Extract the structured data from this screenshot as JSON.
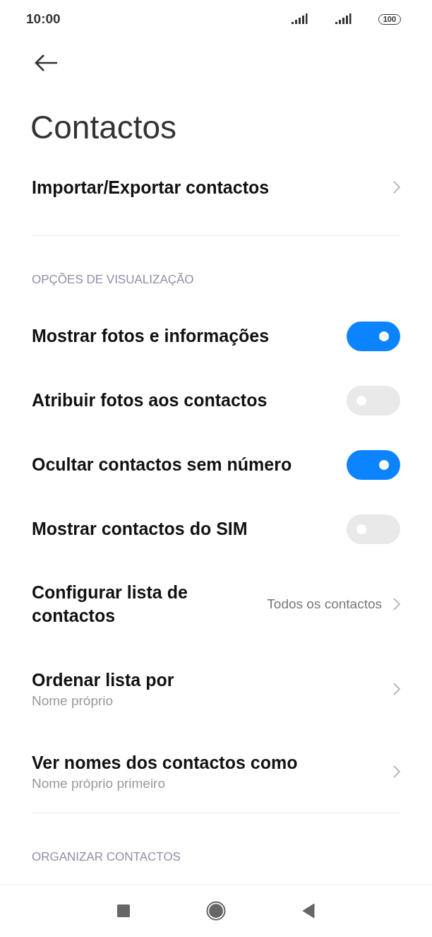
{
  "status_bar": {
    "time": "10:00",
    "battery": "100"
  },
  "title": "Contactos",
  "top_item": {
    "label": "Importar/Exportar contactos"
  },
  "sections": [
    {
      "header": "OPÇÕES DE VISUALIZAÇÃO",
      "items": [
        {
          "kind": "toggle",
          "label": "Mostrar fotos e informações",
          "on": true
        },
        {
          "kind": "toggle",
          "label": "Atribuir fotos aos contactos",
          "on": false
        },
        {
          "kind": "toggle",
          "label": "Ocultar contactos sem número",
          "on": true
        },
        {
          "kind": "toggle",
          "label": "Mostrar contactos do SIM",
          "on": false
        },
        {
          "kind": "value",
          "label": "Configurar lista de contactos",
          "value": "Todos os contactos"
        },
        {
          "kind": "sub",
          "label": "Ordenar lista por",
          "sub": "Nome próprio"
        },
        {
          "kind": "sub",
          "label": "Ver nomes dos contactos como",
          "sub": "Nome próprio primeiro"
        }
      ]
    },
    {
      "header": "ORGANIZAR CONTACTOS"
    }
  ]
}
